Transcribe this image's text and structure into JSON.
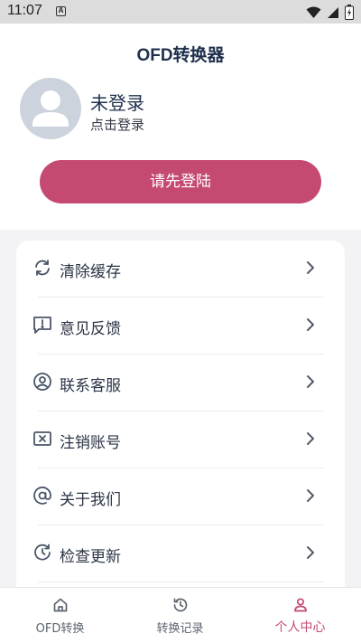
{
  "status_bar": {
    "time": "11:07",
    "a_badge": "A"
  },
  "header": {
    "title": "OFD转换器",
    "login_status": "未登录",
    "login_hint": "点击登录",
    "login_button": "请先登陆"
  },
  "menu": {
    "items": [
      {
        "label": "清除缓存",
        "icon": "refresh-icon"
      },
      {
        "label": "意见反馈",
        "icon": "feedback-icon"
      },
      {
        "label": "联系客服",
        "icon": "user-circle-icon"
      },
      {
        "label": "注销账号",
        "icon": "close-box-icon"
      },
      {
        "label": "关于我们",
        "icon": "at-icon"
      },
      {
        "label": "检查更新",
        "icon": "update-icon"
      }
    ]
  },
  "tabs": [
    {
      "label": "OFD转换",
      "icon": "home-icon",
      "active": false
    },
    {
      "label": "转换记录",
      "icon": "history-icon",
      "active": false
    },
    {
      "label": "个人中心",
      "icon": "person-icon",
      "active": true
    }
  ],
  "colors": {
    "accent": "#c54a72",
    "title": "#1f2f4d",
    "icon": "#4a5568"
  }
}
